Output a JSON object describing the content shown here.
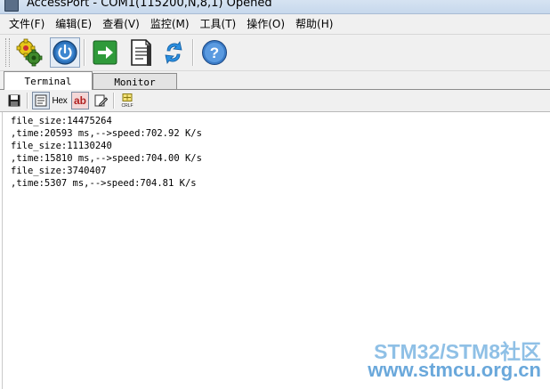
{
  "window": {
    "title": "AccessPort - COM1(115200,N,8,1) Opened"
  },
  "menu": [
    {
      "label": "文件(F)"
    },
    {
      "label": "编辑(E)"
    },
    {
      "label": "查看(V)"
    },
    {
      "label": "监控(M)"
    },
    {
      "label": "工具(T)"
    },
    {
      "label": "操作(O)"
    },
    {
      "label": "帮助(H)"
    }
  ],
  "toolbar": {
    "icons": [
      "settings-gears-icon",
      "power-icon",
      "send-arrow-icon",
      "document-icon",
      "refresh-arrows-icon",
      "help-icon"
    ]
  },
  "tabs": [
    {
      "label": "Terminal",
      "active": true
    },
    {
      "label": "Monitor",
      "active": false
    }
  ],
  "subtoolbar": {
    "hex_label": "Hex",
    "ab_label": "ab",
    "crlf_label": "CRLF"
  },
  "terminal": {
    "lines": [
      "file_size:14475264",
      ",time:20593 ms,-->speed:702.92 K/s",
      "file_size:11130240",
      ",time:15810 ms,-->speed:704.00 K/s",
      "file_size:3740407",
      ",time:5307 ms,-->speed:704.81 K/s"
    ]
  },
  "watermark": {
    "line1": "STM32/STM8社区",
    "line2": "www.stmcu.org.cn"
  }
}
